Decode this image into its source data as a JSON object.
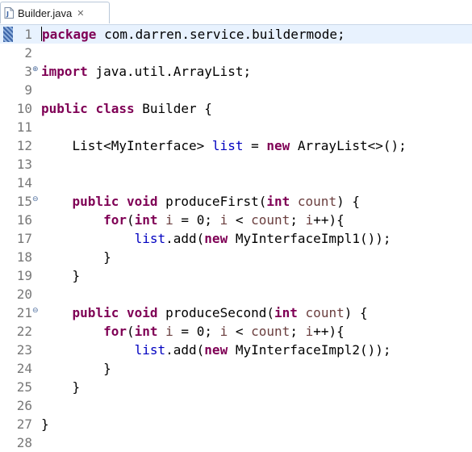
{
  "tab": {
    "title": "Builder.java",
    "close": "✕"
  },
  "lines": [
    {
      "n": "1",
      "tokens": [
        {
          "t": "package",
          "c": "kw"
        },
        {
          "t": " com.darren.service.buildermode;"
        }
      ],
      "current": true
    },
    {
      "n": "2",
      "tokens": []
    },
    {
      "n": "3",
      "fold": "⊕",
      "tokens": [
        {
          "t": "import",
          "c": "kw"
        },
        {
          "t": " java.util.ArrayList;"
        }
      ]
    },
    {
      "n": "9",
      "tokens": []
    },
    {
      "n": "10",
      "tokens": [
        {
          "t": "public",
          "c": "kw"
        },
        {
          "t": " "
        },
        {
          "t": "class",
          "c": "kw"
        },
        {
          "t": " Builder {"
        }
      ]
    },
    {
      "n": "11",
      "tokens": []
    },
    {
      "n": "12",
      "tokens": [
        {
          "t": "    List<MyInterface> "
        },
        {
          "t": "list",
          "c": "field"
        },
        {
          "t": " = "
        },
        {
          "t": "new",
          "c": "kw"
        },
        {
          "t": " ArrayList<>();"
        }
      ]
    },
    {
      "n": "13",
      "tokens": []
    },
    {
      "n": "14",
      "tokens": []
    },
    {
      "n": "15",
      "fold": "⊖",
      "tokens": [
        {
          "t": "    "
        },
        {
          "t": "public",
          "c": "kw"
        },
        {
          "t": " "
        },
        {
          "t": "void",
          "c": "kw"
        },
        {
          "t": " produceFirst("
        },
        {
          "t": "int",
          "c": "kw"
        },
        {
          "t": " "
        },
        {
          "t": "count",
          "c": "param"
        },
        {
          "t": ") {"
        }
      ]
    },
    {
      "n": "16",
      "tokens": [
        {
          "t": "        "
        },
        {
          "t": "for",
          "c": "kw"
        },
        {
          "t": "("
        },
        {
          "t": "int",
          "c": "kw"
        },
        {
          "t": " "
        },
        {
          "t": "i",
          "c": "param"
        },
        {
          "t": " = 0; "
        },
        {
          "t": "i",
          "c": "param"
        },
        {
          "t": " < "
        },
        {
          "t": "count",
          "c": "param"
        },
        {
          "t": "; "
        },
        {
          "t": "i",
          "c": "param"
        },
        {
          "t": "++){"
        }
      ]
    },
    {
      "n": "17",
      "tokens": [
        {
          "t": "            "
        },
        {
          "t": "list",
          "c": "field"
        },
        {
          "t": ".add("
        },
        {
          "t": "new",
          "c": "kw"
        },
        {
          "t": " MyInterfaceImpl1());"
        }
      ]
    },
    {
      "n": "18",
      "tokens": [
        {
          "t": "        }"
        }
      ]
    },
    {
      "n": "19",
      "tokens": [
        {
          "t": "    }"
        }
      ]
    },
    {
      "n": "20",
      "tokens": []
    },
    {
      "n": "21",
      "fold": "⊖",
      "tokens": [
        {
          "t": "    "
        },
        {
          "t": "public",
          "c": "kw"
        },
        {
          "t": " "
        },
        {
          "t": "void",
          "c": "kw"
        },
        {
          "t": " produceSecond("
        },
        {
          "t": "int",
          "c": "kw"
        },
        {
          "t": " "
        },
        {
          "t": "count",
          "c": "param"
        },
        {
          "t": ") {"
        }
      ]
    },
    {
      "n": "22",
      "tokens": [
        {
          "t": "        "
        },
        {
          "t": "for",
          "c": "kw"
        },
        {
          "t": "("
        },
        {
          "t": "int",
          "c": "kw"
        },
        {
          "t": " "
        },
        {
          "t": "i",
          "c": "param"
        },
        {
          "t": " = 0; "
        },
        {
          "t": "i",
          "c": "param"
        },
        {
          "t": " < "
        },
        {
          "t": "count",
          "c": "param"
        },
        {
          "t": "; "
        },
        {
          "t": "i",
          "c": "param"
        },
        {
          "t": "++){"
        }
      ]
    },
    {
      "n": "23",
      "tokens": [
        {
          "t": "            "
        },
        {
          "t": "list",
          "c": "field"
        },
        {
          "t": ".add("
        },
        {
          "t": "new",
          "c": "kw"
        },
        {
          "t": " MyInterfaceImpl2());"
        }
      ]
    },
    {
      "n": "24",
      "tokens": [
        {
          "t": "        }"
        }
      ]
    },
    {
      "n": "25",
      "tokens": [
        {
          "t": "    }"
        }
      ]
    },
    {
      "n": "26",
      "tokens": []
    },
    {
      "n": "27",
      "tokens": [
        {
          "t": "}"
        }
      ]
    },
    {
      "n": "28",
      "tokens": []
    }
  ],
  "colors": {
    "keyword": "#7f0055",
    "field": "#0000c0",
    "variable": "#6a3e3e",
    "line_number": "#787878",
    "current_line": "#e8f2fe"
  },
  "icons": {
    "tab_file": "java-file-icon",
    "tab_close": "close-icon"
  }
}
